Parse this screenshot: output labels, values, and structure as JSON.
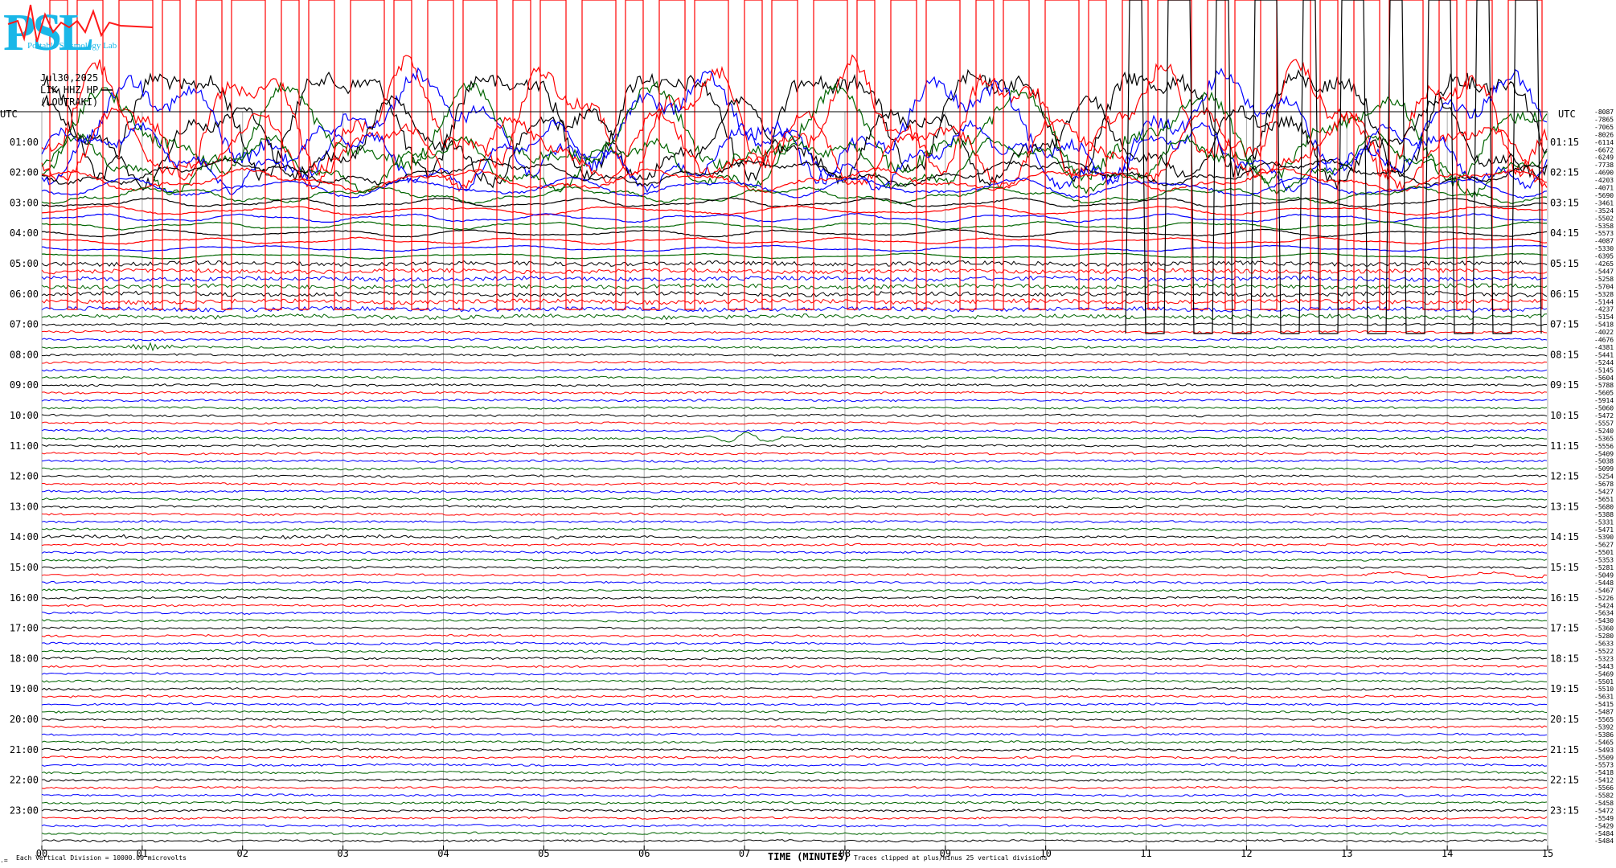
{
  "header": {
    "logo_text": "PSL",
    "logo_subtitle": "Portable Seismology Lab",
    "date": "Jul30,2025",
    "station": "LIK HHZ HP",
    "location": "(LOUTRAKI)",
    "left_axis_title": "UTC",
    "right_axis_title": "UTC"
  },
  "chart_data": {
    "type": "line",
    "title": "",
    "xlabel": "TIME (MINUTES)",
    "ylabel": "",
    "xlim": [
      0,
      15
    ],
    "x_ticks": [
      "00",
      "01",
      "02",
      "03",
      "04",
      "05",
      "06",
      "07",
      "08",
      "09",
      "10",
      "11",
      "12",
      "13",
      "14",
      "15"
    ],
    "left_hour_labels": [
      "01:00",
      "02:00",
      "03:00",
      "04:00",
      "05:00",
      "06:00",
      "07:00",
      "08:00",
      "09:00",
      "10:00",
      "11:00",
      "12:00",
      "13:00",
      "14:00",
      "15:00",
      "16:00",
      "17:00",
      "18:00",
      "19:00",
      "20:00",
      "21:00",
      "22:00",
      "23:00"
    ],
    "right_hour_labels": [
      "01:15",
      "02:15",
      "03:15",
      "04:15",
      "05:15",
      "06:15",
      "07:15",
      "08:15",
      "09:15",
      "10:15",
      "11:15",
      "12:15",
      "13:15",
      "14:15",
      "15:15",
      "16:15",
      "17:15",
      "18:15",
      "19:15",
      "20:15",
      "21:15",
      "22:15",
      "23:15"
    ],
    "trace_colors": [
      "#000000",
      "#ff0000",
      "#0000ff",
      "#006400"
    ],
    "trace_offsets": [
      -8087,
      -7865,
      -7065,
      -8026,
      -6114,
      -6672,
      -6249,
      -7738,
      -4690,
      -4203,
      -4071,
      -5690,
      -3461,
      -3524,
      -5502,
      -5358,
      -5573,
      -4087,
      -5330,
      -6395,
      -4265,
      -5447,
      -5258,
      -5704,
      -5328,
      -5144,
      -4237,
      -5154,
      -5418,
      -4022,
      -4676,
      -4381,
      -5441,
      -5244,
      -5145,
      -5604,
      -5788,
      -5605,
      -5914,
      -5060,
      -5472,
      -5557,
      -5240,
      -5365,
      -5556,
      -5409,
      -5038,
      -5099,
      -5254,
      -5678,
      -5427,
      -5651,
      -5680,
      -5388,
      -5331,
      -5471,
      -5390,
      -5627,
      -5501,
      -5353,
      -5281,
      -5049,
      -5448,
      -5467,
      -5226,
      -5424,
      -5634,
      -5430,
      -5360,
      -5280,
      -5633,
      -5522,
      -5323,
      -5443,
      -5469,
      -5501,
      -5510,
      -5631,
      -5415,
      -5487,
      -5565,
      -5392,
      -5386,
      -5465,
      -5493,
      -5509,
      -5573,
      -5418,
      -5412,
      -5566,
      -5582,
      -5458,
      -5472,
      -5549,
      -5429,
      -5484,
      -5484
    ],
    "footer_left": "Each Vertical Division = 10000.00 microvolts",
    "footer_right": "Traces clipped at plus/minus 25 vertical divisions"
  }
}
